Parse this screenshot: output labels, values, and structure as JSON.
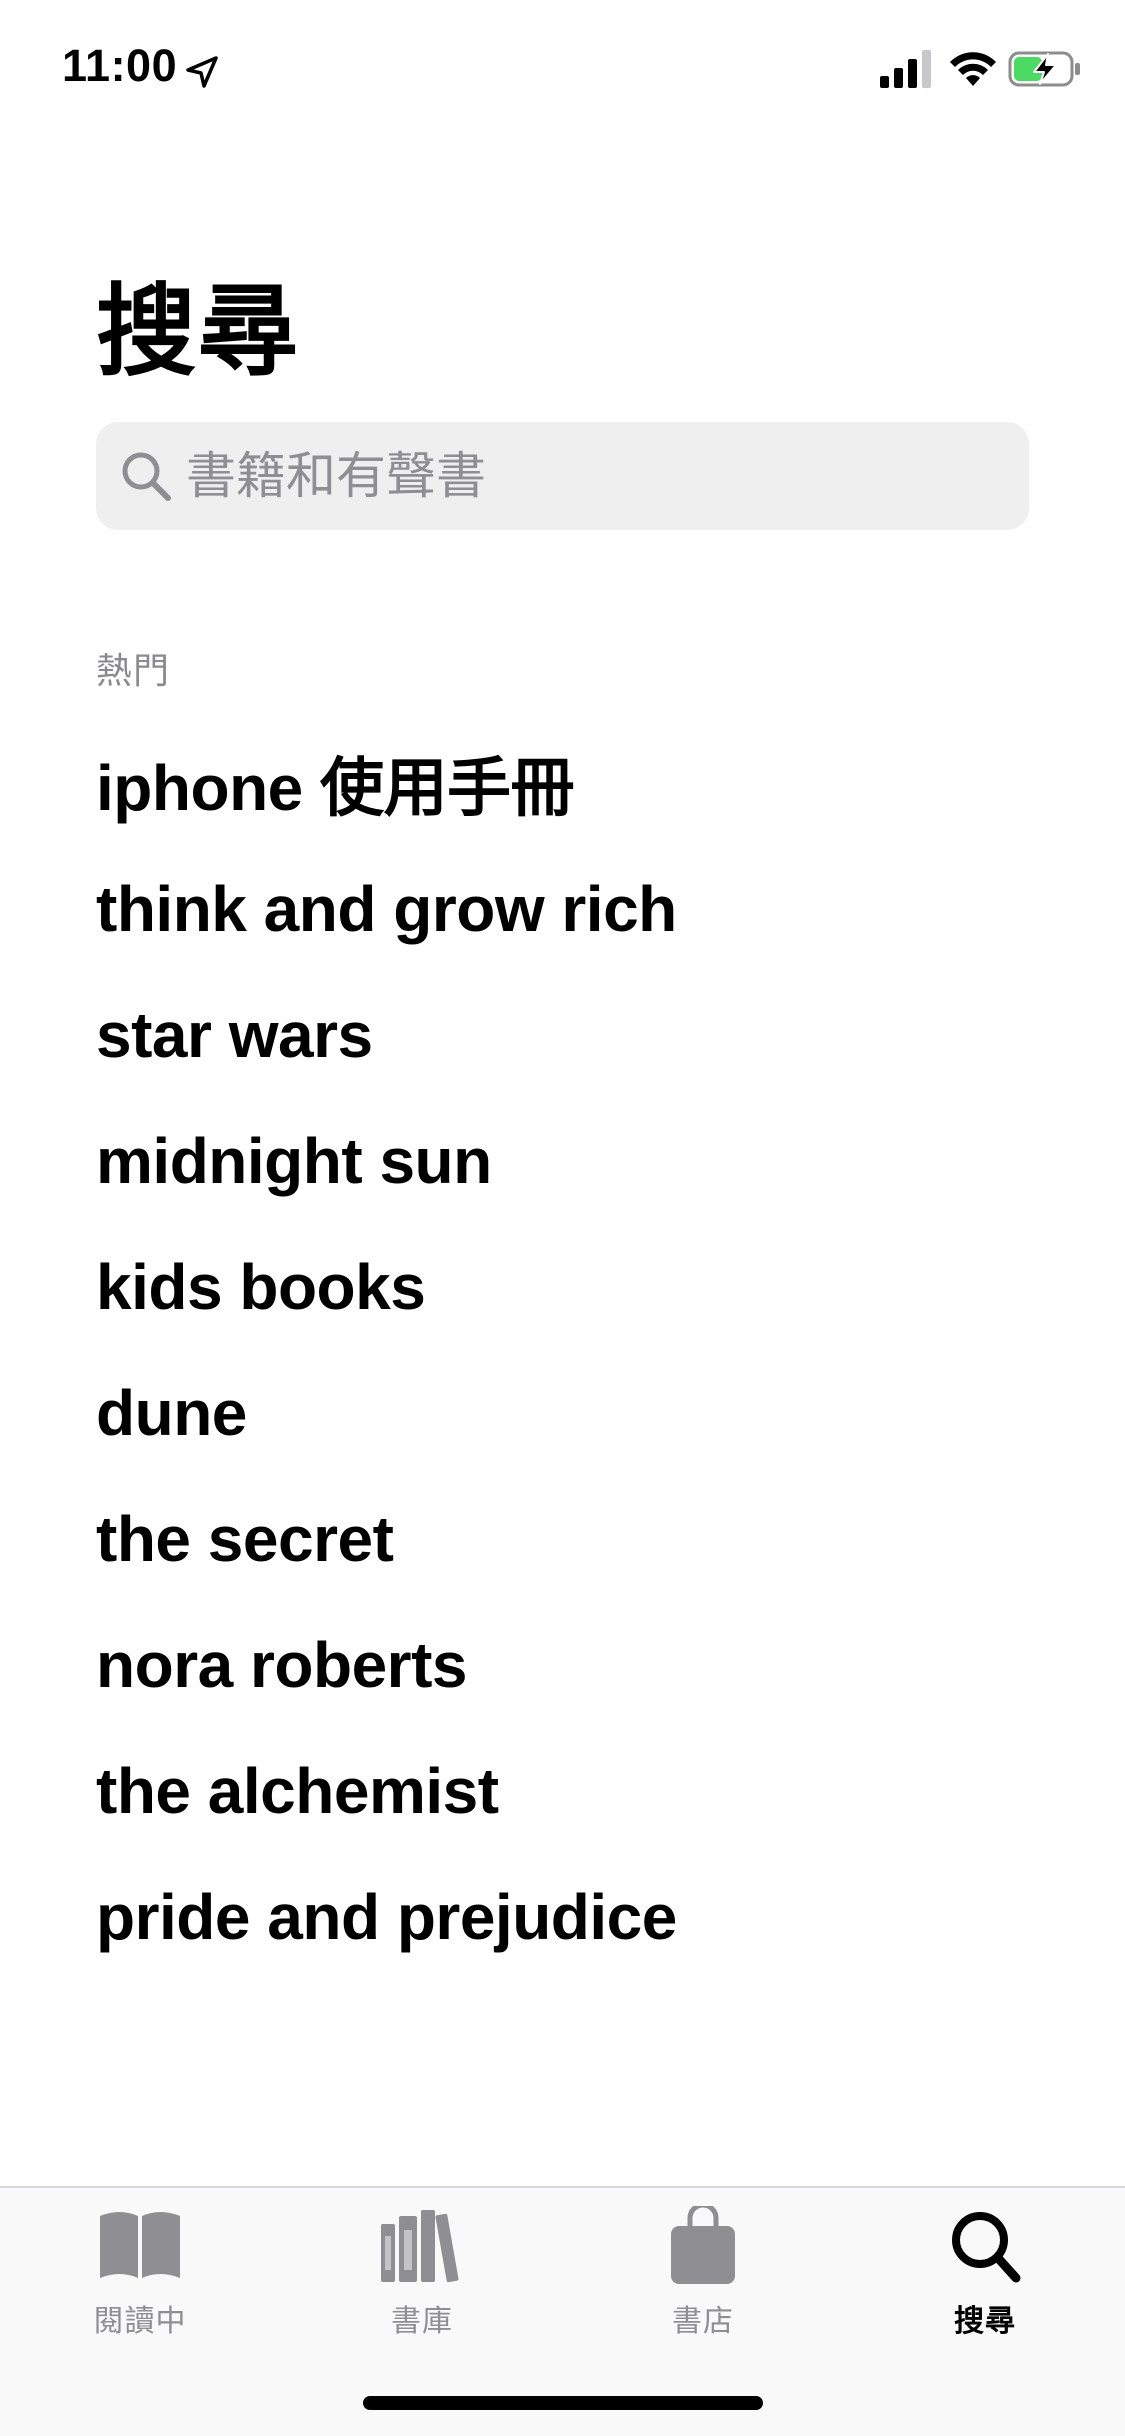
{
  "status_bar": {
    "time": "11:00"
  },
  "title": "搜尋",
  "search": {
    "placeholder": "書籍和有聲書",
    "value": ""
  },
  "trending": {
    "label": "熱門",
    "items": [
      "iphone 使用手冊",
      "think and grow rich",
      "star wars",
      "midnight sun",
      "kids books",
      "dune",
      "the secret",
      "nora roberts",
      "the alchemist",
      "pride and prejudice"
    ]
  },
  "tabs": [
    {
      "label": "閱讀中",
      "icon": "open-book-icon",
      "active": false
    },
    {
      "label": "書庫",
      "icon": "library-icon",
      "active": false
    },
    {
      "label": "書店",
      "icon": "bag-icon",
      "active": false
    },
    {
      "label": "搜尋",
      "icon": "search-icon",
      "active": true
    }
  ],
  "colors": {
    "active_tab": "#000000",
    "inactive_tab": "#8e8e93",
    "search_bg": "#efeff0",
    "battery_charge": "#4cd964"
  }
}
